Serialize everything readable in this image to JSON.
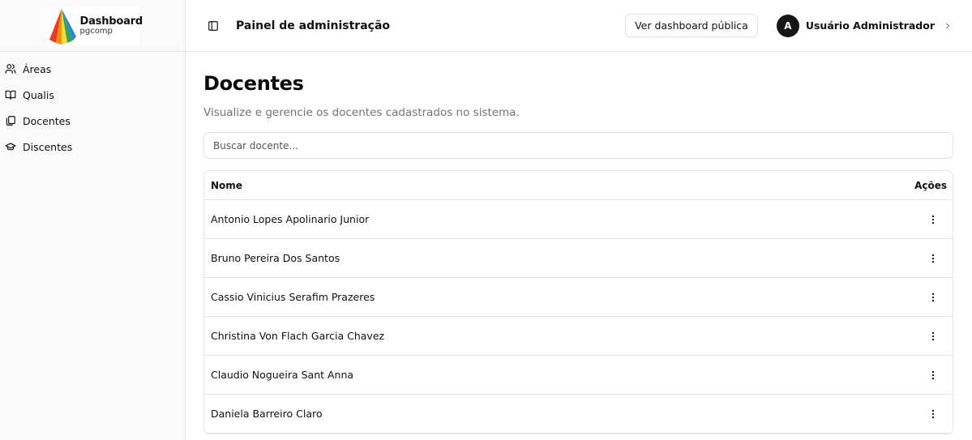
{
  "logo": {
    "title": "Dashboard",
    "subtitle": "pgcomp"
  },
  "sidebar": {
    "items": [
      {
        "label": "Áreas",
        "icon": "users-icon"
      },
      {
        "label": "Qualis",
        "icon": "book-open-icon"
      },
      {
        "label": "Docentes",
        "icon": "library-icon"
      },
      {
        "label": "Discentes",
        "icon": "graduation-cap-icon"
      }
    ]
  },
  "header": {
    "title": "Painel de administração",
    "public_button": "Ver dashboard pública",
    "user": {
      "initial": "A",
      "name": "Usuário Administrador"
    }
  },
  "main": {
    "title": "Docentes",
    "description": "Visualize e gerencie os docentes cadastrados no sistema.",
    "search_placeholder": "Buscar docente...",
    "table": {
      "columns": [
        "Nome",
        "Ações"
      ],
      "rows": [
        "Antonio Lopes Apolinario Junior",
        "Bruno Pereira Dos Santos",
        "Cassio Vinicius Serafim Prazeres",
        "Christina Von Flach Garcia Chavez",
        "Claudio Nogueira Sant Anna",
        "Daniela Barreiro Claro"
      ]
    }
  },
  "colors": {
    "accent": "#171717",
    "border": "#e5e5e5",
    "sidebar_bg": "#fafafa",
    "muted_text": "#737373"
  }
}
